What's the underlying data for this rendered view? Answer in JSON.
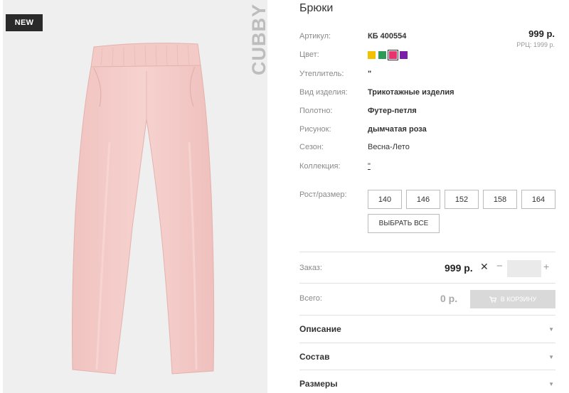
{
  "product": {
    "badge": "NEW",
    "brand": "CUBBY",
    "title": "Брюки",
    "price": "999 р.",
    "rrp": "РРЦ: 1999 р."
  },
  "attributes": [
    {
      "label": "Артикул:",
      "value": "КБ 400554"
    },
    {
      "label": "Цвет:",
      "value": ""
    },
    {
      "label": "Утеплитель:",
      "value": "\""
    },
    {
      "label": "Вид изделия:",
      "value": "Трикотажные изделия"
    },
    {
      "label": "Полотно:",
      "value": "Футер-петля"
    },
    {
      "label": "Рисунок:",
      "value": "дымчатая роза"
    },
    {
      "label": "Сезон:",
      "value": "Весна-Лето"
    },
    {
      "label": "Коллекция:",
      "value": "\""
    }
  ],
  "colors": [
    "#f2c200",
    "#2e9a55",
    "#e8336e",
    "#7a1fa8"
  ],
  "selected_color_index": 2,
  "sizes": {
    "label": "Рост/размер:",
    "options": [
      "140",
      "146",
      "152",
      "158",
      "164"
    ],
    "select_all": "ВЫБРАТЬ ВСЕ"
  },
  "order": {
    "label": "Заказ:",
    "price": "999 р.",
    "times": "✕",
    "minus": "−",
    "plus": "+",
    "quantity": ""
  },
  "total": {
    "label": "Всего:",
    "value": "0 р.",
    "cart_button": "В КОРЗИНУ"
  },
  "accordions": [
    {
      "label": "Описание"
    },
    {
      "label": "Состав"
    },
    {
      "label": "Размеры"
    }
  ]
}
